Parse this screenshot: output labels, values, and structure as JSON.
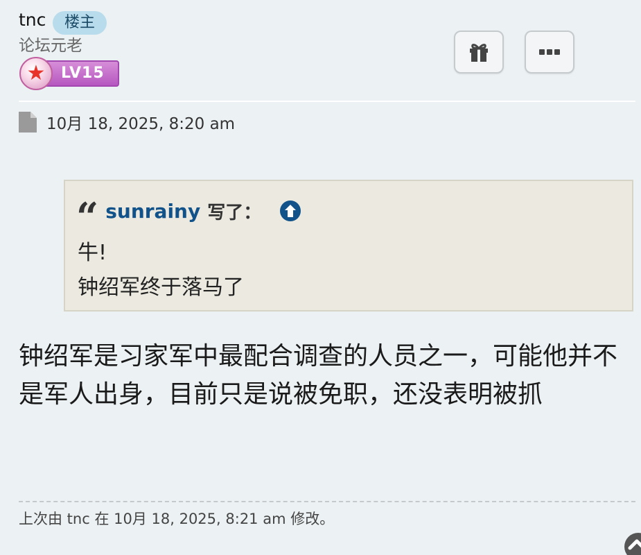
{
  "author": {
    "username": "tnc",
    "owner_badge": "楼主",
    "rank": "论坛元老",
    "level": "LV15"
  },
  "actions": {
    "gift_icon": "gift-icon",
    "more_icon": "more-icon"
  },
  "post": {
    "date": "10月 18, 2025, 8:20 am",
    "quote": {
      "author": "sunrainy",
      "wrote": "写了：",
      "lines": [
        "牛!",
        "钟绍军终于落马了"
      ]
    },
    "content": "钟绍军是习家军中最配合调查的人员之一，可能他并不是军人出身，目前只是说被免职，还没表明被抓",
    "edit_note": "上次由 tnc 在 10月 18, 2025, 8:21 am 修改。"
  },
  "colors": {
    "background": "#ecf1f3",
    "link": "#105289",
    "badge": "#b9dcec",
    "quote_bg": "#ebe9e0"
  }
}
